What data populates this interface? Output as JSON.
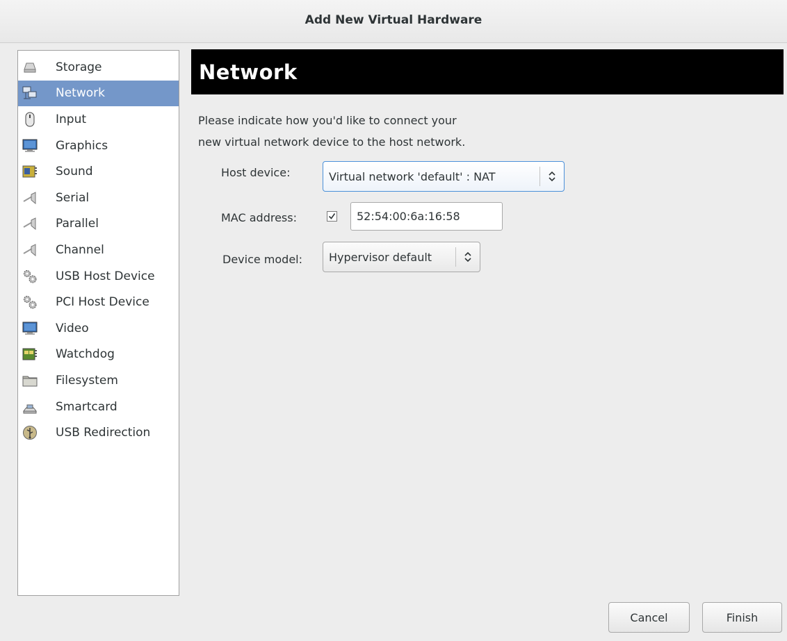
{
  "window": {
    "title": "Add New Virtual Hardware"
  },
  "sidebar": {
    "selected_index": 1,
    "items": [
      {
        "label": "Storage",
        "icon": "storage-disk-icon"
      },
      {
        "label": "Network",
        "icon": "network-icon"
      },
      {
        "label": "Input",
        "icon": "mouse-icon"
      },
      {
        "label": "Graphics",
        "icon": "monitor-icon"
      },
      {
        "label": "Sound",
        "icon": "sound-card-icon"
      },
      {
        "label": "Serial",
        "icon": "serial-connector-icon"
      },
      {
        "label": "Parallel",
        "icon": "parallel-connector-icon"
      },
      {
        "label": "Channel",
        "icon": "channel-connector-icon"
      },
      {
        "label": "USB Host Device",
        "icon": "gears-icon"
      },
      {
        "label": "PCI Host Device",
        "icon": "gears-icon"
      },
      {
        "label": "Video",
        "icon": "monitor-icon"
      },
      {
        "label": "Watchdog",
        "icon": "watchdog-card-icon"
      },
      {
        "label": "Filesystem",
        "icon": "folder-icon"
      },
      {
        "label": "Smartcard",
        "icon": "smartcard-reader-icon"
      },
      {
        "label": "USB Redirection",
        "icon": "usb-icon"
      }
    ]
  },
  "main": {
    "header": "Network",
    "description_line1": "Please indicate how you'd like to connect your",
    "description_line2": "new virtual network device to the host network.",
    "host_device": {
      "label": "Host device:",
      "value": "Virtual network 'default' : NAT"
    },
    "mac_address": {
      "label": "MAC address:",
      "checked": true,
      "value": "52:54:00:6a:16:58"
    },
    "device_model": {
      "label": "Device model:",
      "value": "Hypervisor default"
    }
  },
  "buttons": {
    "cancel": "Cancel",
    "finish": "Finish"
  },
  "colors": {
    "selection": "#7497c9",
    "header_bg": "#000000",
    "window_bg": "#ededed"
  }
}
